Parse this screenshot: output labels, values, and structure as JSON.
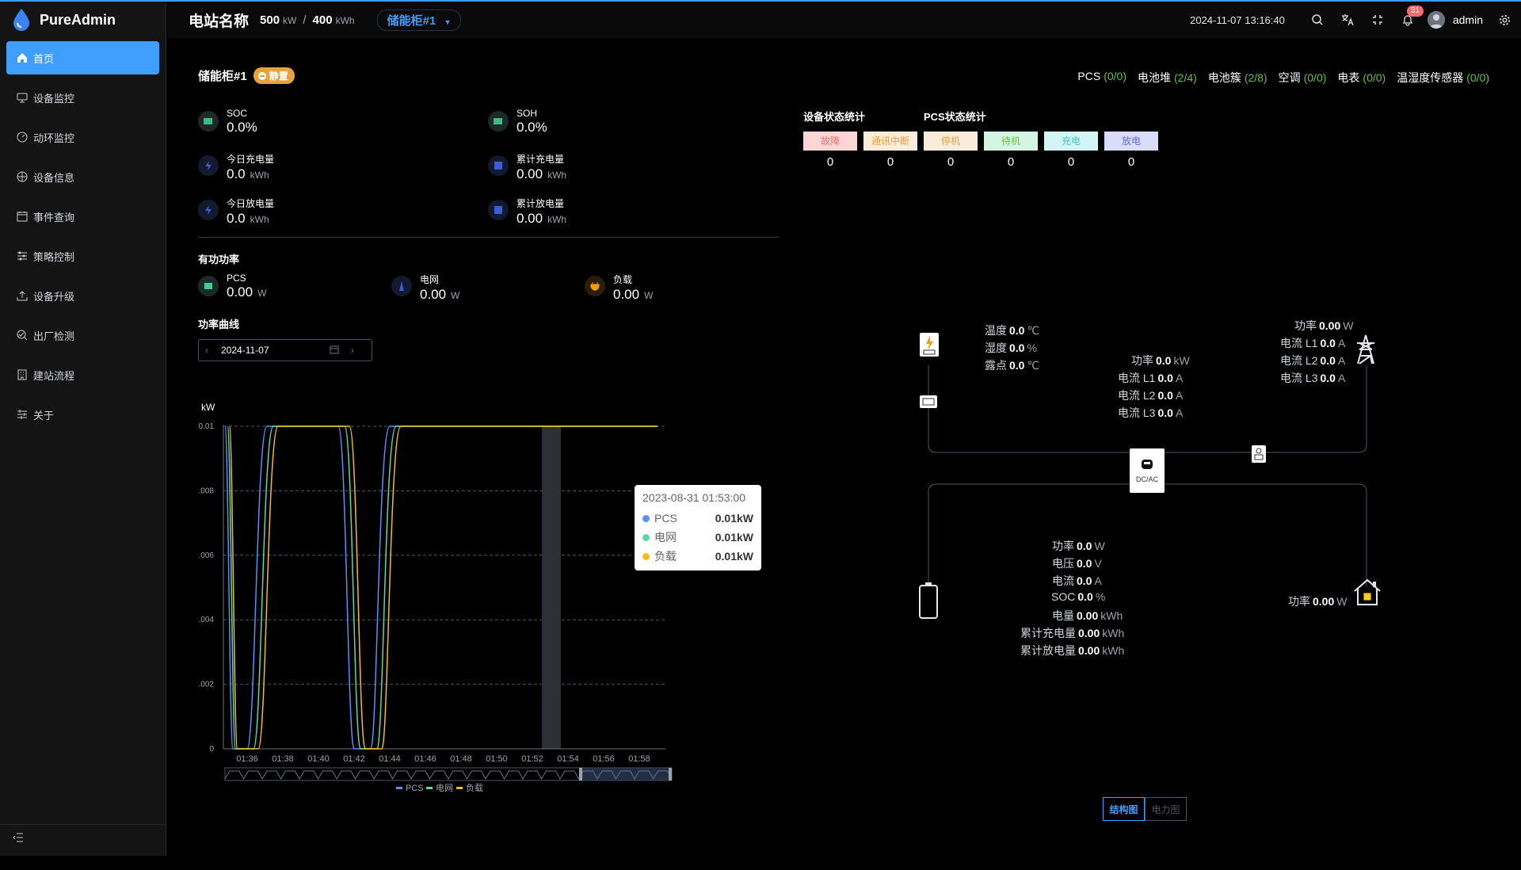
{
  "app": {
    "name": "PureAdmin"
  },
  "sidebar": {
    "items": [
      {
        "label": "首页",
        "icon": "home-icon"
      },
      {
        "label": "设备监控",
        "icon": "monitor-icon"
      },
      {
        "label": "动环监控",
        "icon": "gauge-icon"
      },
      {
        "label": "设备信息",
        "icon": "info-icon"
      },
      {
        "label": "事件查询",
        "icon": "calendar-icon"
      },
      {
        "label": "策略控制",
        "icon": "sliders-icon"
      },
      {
        "label": "设备升级",
        "icon": "upload-icon"
      },
      {
        "label": "出厂检测",
        "icon": "check-icon"
      },
      {
        "label": "建站流程",
        "icon": "building-icon"
      },
      {
        "label": "关于",
        "icon": "about-icon"
      }
    ]
  },
  "header": {
    "station_name": "电站名称",
    "power": "500",
    "power_unit": "kW",
    "slash": "/",
    "capacity": "400",
    "capacity_unit": "kWh",
    "cabinet": "储能柜#1",
    "datetime": "2024-11-07 13:16:40",
    "notification_count": "31",
    "username": "admin"
  },
  "cabinet": {
    "title": "储能柜#1",
    "status": "静置"
  },
  "counts": [
    {
      "label": "PCS",
      "value": "(0/0)"
    },
    {
      "label": "电池堆",
      "value": "(2/4)"
    },
    {
      "label": "电池簇",
      "value": "(2/8)"
    },
    {
      "label": "空调",
      "value": "(0/0)"
    },
    {
      "label": "电表",
      "value": "(0/0)"
    },
    {
      "label": "温湿度传感器",
      "value": "(0/0)"
    }
  ],
  "kpis": {
    "soc": {
      "label": "SOC",
      "value": "0.0%"
    },
    "soh": {
      "label": "SOH",
      "value": "0.0%"
    },
    "today_charge": {
      "label": "今日充电量",
      "value": "0.0",
      "unit": "kWh"
    },
    "total_charge": {
      "label": "累计充电量",
      "value": "0.00",
      "unit": "kWh"
    },
    "today_discharge": {
      "label": "今日放电量",
      "value": "0.0",
      "unit": "kWh"
    },
    "total_discharge": {
      "label": "累计放电量",
      "value": "0.00",
      "unit": "kWh"
    }
  },
  "active_power": {
    "title": "有功功率",
    "pcs": {
      "label": "PCS",
      "value": "0.00",
      "unit": "W"
    },
    "grid": {
      "label": "电网",
      "value": "0.00",
      "unit": "W"
    },
    "load": {
      "label": "负载",
      "value": "0.00",
      "unit": "W"
    }
  },
  "power_curve": {
    "title": "功率曲线",
    "date": "2024-11-07"
  },
  "chart_data": {
    "type": "line",
    "ylabel": "kW",
    "ylim": [
      0,
      0.01
    ],
    "yticks": [
      "0",
      "0.002",
      "0.004",
      "0.006",
      "0.008",
      "0.01"
    ],
    "xticks": [
      "01:36",
      "01:38",
      "01:40",
      "01:42",
      "01:44",
      "01:46",
      "01:48",
      "01:50",
      "01:52",
      "01:54",
      "01:56",
      "01:58"
    ],
    "grid": true,
    "legend_position": "bottom",
    "series": [
      {
        "name": "PCS",
        "color": "#5b8ff9"
      },
      {
        "name": "电网",
        "color": "#5ad8a6"
      },
      {
        "name": "负载",
        "color": "#f6bd16"
      }
    ],
    "tooltip": {
      "title": "2023-08-31 01:53:00",
      "rows": [
        {
          "name": "PCS",
          "value": "0.01kW",
          "color": "#5b8ff9"
        },
        {
          "name": "电网",
          "value": "0.01kW",
          "color": "#5ad8a6"
        },
        {
          "name": "负载",
          "value": "0.01kW",
          "color": "#f6bd16"
        }
      ]
    }
  },
  "device_stats": {
    "title": "设备状态统计",
    "items": [
      {
        "label": "故障",
        "value": "0",
        "bg": "#fcd5d5",
        "fg": "#f56c6c"
      },
      {
        "label": "通讯中断",
        "value": "0",
        "bg": "#faecd8",
        "fg": "#e6a23c"
      }
    ]
  },
  "pcs_stats": {
    "title": "PCS状态统计",
    "items": [
      {
        "label": "停机",
        "value": "0",
        "bg": "#faecd8",
        "fg": "#e6a23c"
      },
      {
        "label": "待机",
        "value": "0",
        "bg": "#d5f5e3",
        "fg": "#67c23a"
      },
      {
        "label": "充电",
        "value": "0",
        "bg": "#d5f5f5",
        "fg": "#40c9c6"
      },
      {
        "label": "放电",
        "value": "0",
        "bg": "#d9dcfb",
        "fg": "#5b6cf5"
      }
    ]
  },
  "diagram": {
    "env": {
      "temp_label": "温度",
      "temp": "0.0",
      "temp_unit": "℃",
      "hum_label": "湿度",
      "hum": "0.0",
      "hum_unit": "%",
      "dew_label": "露点",
      "dew": "0.0",
      "dew_unit": "℃"
    },
    "pcs": {
      "power_label": "功率",
      "power": "0.0",
      "power_unit": "kW",
      "l1_label": "电流 L1",
      "l1": "0.0",
      "l2_label": "电流 L2",
      "l2": "0.0",
      "l3_label": "电流 L3",
      "l3": "0.0",
      "cur_unit": "A"
    },
    "grid": {
      "power_label": "功率",
      "power": "0.00",
      "power_unit": "W",
      "l1_label": "电流 L1",
      "l1": "0.0",
      "l2_label": "电流 L2",
      "l2": "0.0",
      "l3_label": "电流 L3",
      "l3": "0.0",
      "cur_unit": "A"
    },
    "dcac_label": "DC/AC",
    "battery": {
      "power_label": "功率",
      "power": "0.0",
      "power_unit": "W",
      "voltage_label": "电压",
      "voltage": "0.0",
      "voltage_unit": "V",
      "current_label": "电流",
      "current": "0.0",
      "current_unit": "A",
      "soc_label": "SOC",
      "soc": "0.0",
      "soc_unit": "%",
      "energy_label": "电量",
      "energy": "0.00",
      "energy_unit": "kWh",
      "tc_label": "累计充电量",
      "tc": "0.00",
      "tc_unit": "kWh",
      "td_label": "累计放电量",
      "td": "0.00",
      "td_unit": "kWh"
    },
    "load": {
      "power_label": "功率",
      "power": "0.00",
      "power_unit": "W"
    }
  },
  "view_tabs": {
    "structure": "结构图",
    "power": "电力图"
  }
}
